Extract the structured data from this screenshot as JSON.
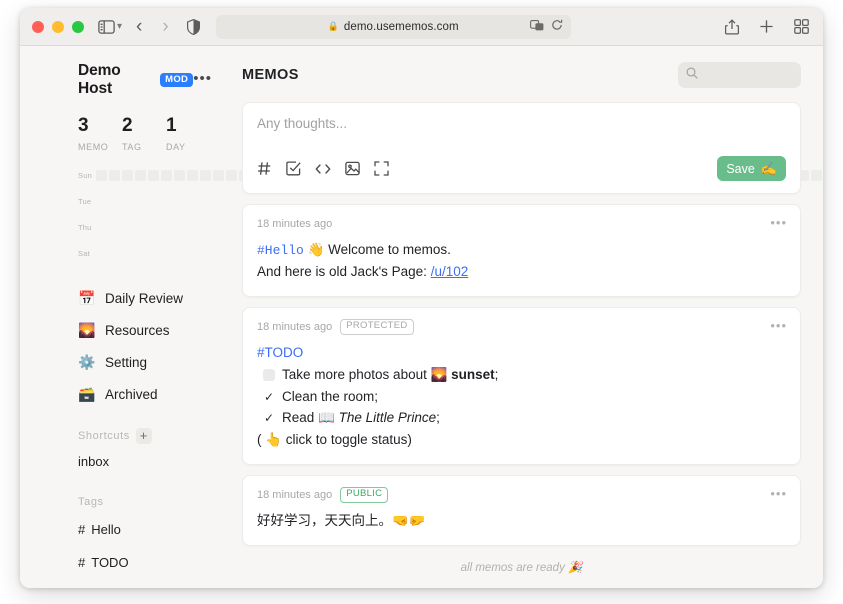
{
  "browser": {
    "url": "demo.usememos.com",
    "lock_icon": "lock-icon",
    "reader_icon": "reader-view-icon",
    "reload_icon": "reload-icon",
    "back_icon": "back-arrow-icon",
    "forward_icon": "forward-arrow-icon",
    "sidebar_icon": "sidebar-toggle-icon",
    "shield_icon": "privacy-shield-icon",
    "share_icon": "share-icon",
    "new_tab_icon": "plus-icon",
    "tab_overview_icon": "tab-overview-icon"
  },
  "sidebar": {
    "user_name": "Demo Host",
    "user_badge": "MOD",
    "menu_icon": "•••",
    "stats": [
      {
        "num": "3",
        "label": "MEMO"
      },
      {
        "num": "2",
        "label": "TAG"
      },
      {
        "num": "1",
        "label": "DAY"
      }
    ],
    "heatmap": {
      "day_labels": [
        "Sun",
        "",
        "Tue",
        "",
        "Thu",
        "",
        "Sat"
      ],
      "columns": 10,
      "rows": 7,
      "active_cells": [
        {
          "col": 9,
          "row": 6,
          "level": 4
        }
      ],
      "empty_color": "#ececea",
      "active_color": "#219a4a"
    },
    "nav": [
      {
        "emoji": "📅",
        "label": "Daily Review",
        "icon_name": "calendar-icon"
      },
      {
        "emoji": "🌄",
        "label": "Resources",
        "icon_name": "sunrise-icon"
      },
      {
        "emoji": "⚙️",
        "label": "Setting",
        "icon_name": "gear-icon"
      },
      {
        "emoji": "🗃️",
        "label": "Archived",
        "icon_name": "file-box-icon"
      }
    ],
    "shortcuts_heading": "Shortcuts",
    "shortcuts_add": "+",
    "shortcuts": [
      {
        "label": "inbox"
      }
    ],
    "tags_heading": "Tags",
    "tags": [
      {
        "hash": "#",
        "label": "Hello"
      },
      {
        "hash": "#",
        "label": "TODO"
      }
    ]
  },
  "main": {
    "title": "MEMOS",
    "search_placeholder": "",
    "search_icon": "search-icon",
    "editor": {
      "placeholder": "Any thoughts...",
      "tools": [
        {
          "name": "hash-tag-icon",
          "glyph": "#"
        },
        {
          "name": "checkbox-icon",
          "glyph": "☑"
        },
        {
          "name": "code-icon",
          "glyph": "<>"
        },
        {
          "name": "image-icon",
          "glyph": "🖼"
        },
        {
          "name": "fullscreen-icon",
          "glyph": "⛶"
        }
      ],
      "save_label": "Save",
      "save_emoji": "✍️",
      "save_color": "#68bd8a"
    },
    "memos": [
      {
        "time": "18 minutes ago",
        "visibility": null,
        "kebab": "•••",
        "lines": [
          {
            "type": "rich",
            "parts": [
              {
                "style": "tag-mono",
                "text": "#Hello"
              },
              {
                "style": "plain",
                "text": " 👋 Welcome to memos."
              }
            ]
          },
          {
            "type": "rich",
            "parts": [
              {
                "style": "plain",
                "text": "And here is old Jack's Page: "
              },
              {
                "style": "link",
                "text": "/u/102"
              }
            ]
          }
        ]
      },
      {
        "time": "18 minutes ago",
        "visibility": "PROTECTED",
        "visibility_style": "protected",
        "kebab": "•••",
        "lines": [
          {
            "type": "rich",
            "parts": [
              {
                "style": "tag-plain",
                "text": "#TODO"
              }
            ]
          },
          {
            "type": "todo",
            "checked": false,
            "parts": [
              {
                "style": "plain",
                "text": "Take more photos about 🌄 "
              },
              {
                "style": "bold",
                "text": "sunset"
              },
              {
                "style": "plain",
                "text": ";"
              }
            ]
          },
          {
            "type": "todo",
            "checked": true,
            "parts": [
              {
                "style": "plain",
                "text": "Clean the room;"
              }
            ]
          },
          {
            "type": "todo",
            "checked": true,
            "parts": [
              {
                "style": "plain",
                "text": "Read 📖 "
              },
              {
                "style": "ital",
                "text": "The Little Prince"
              },
              {
                "style": "plain",
                "text": ";"
              }
            ]
          },
          {
            "type": "rich",
            "parts": [
              {
                "style": "plain",
                "text": "( 👆 click to toggle status)"
              }
            ]
          }
        ]
      },
      {
        "time": "18 minutes ago",
        "visibility": "PUBLIC",
        "visibility_style": "public",
        "kebab": "•••",
        "lines": [
          {
            "type": "rich",
            "parts": [
              {
                "style": "plain",
                "text": "好好学习，天天向上。🤜🤛"
              }
            ]
          }
        ]
      }
    ],
    "footer_note": "all memos are ready 🎉"
  }
}
